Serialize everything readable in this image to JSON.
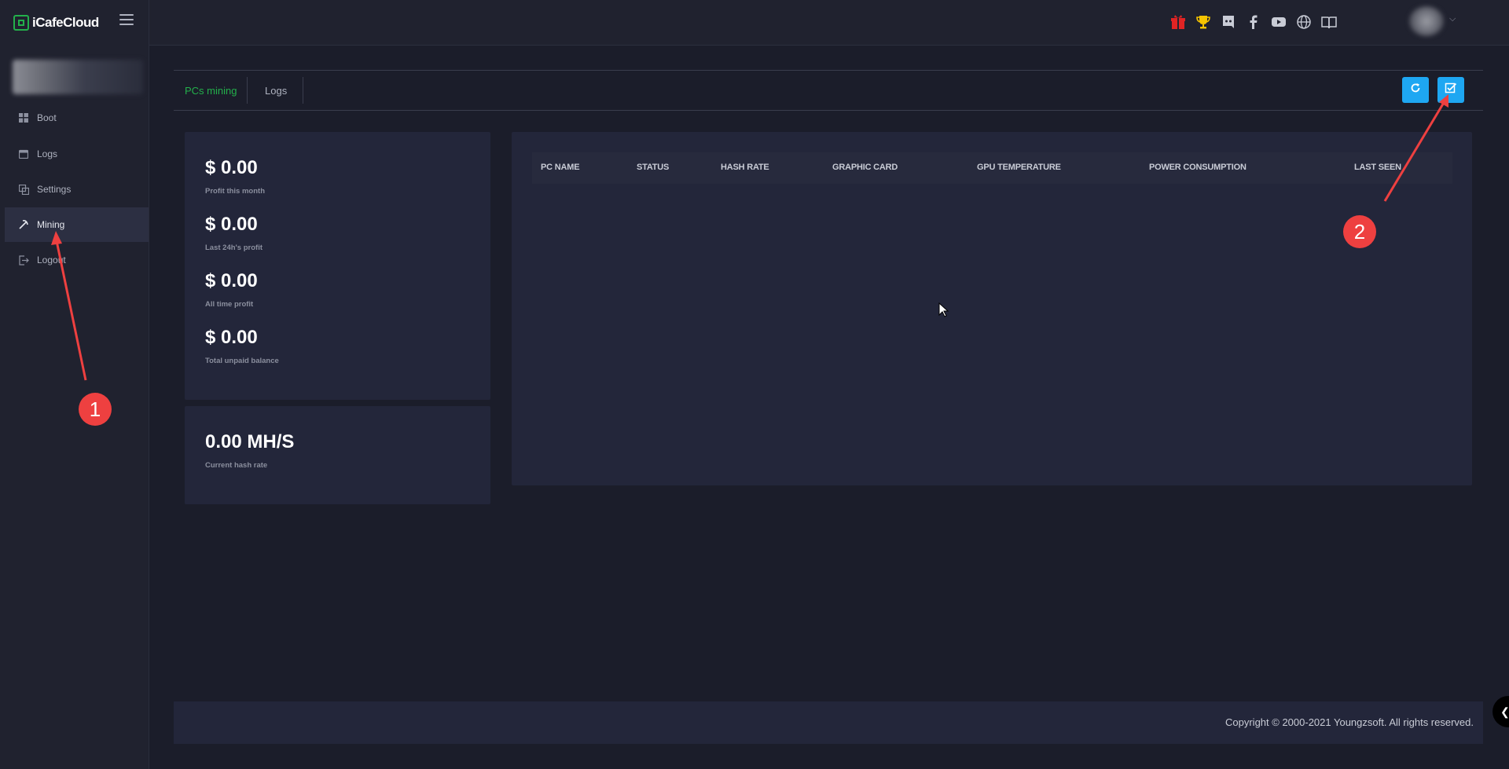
{
  "app": {
    "logo_text": "iCafeCloud"
  },
  "sidebar": {
    "items": [
      {
        "label": "Boot",
        "icon": "windows-icon"
      },
      {
        "label": "Logs",
        "icon": "calendar-icon"
      },
      {
        "label": "Settings",
        "icon": "settings-icon"
      },
      {
        "label": "Mining",
        "icon": "pickaxe-icon",
        "active": true
      },
      {
        "label": "Logout",
        "icon": "logout-icon"
      }
    ]
  },
  "topbar": {
    "icons": [
      "gift-icon",
      "trophy-icon",
      "discord-icon",
      "facebook-icon",
      "youtube-icon",
      "globe-icon",
      "book-icon"
    ]
  },
  "tabs": [
    {
      "label": "PCs mining",
      "active": true
    },
    {
      "label": "Logs",
      "active": false
    }
  ],
  "actions": {
    "refresh_icon": "refresh-icon",
    "checklist_icon": "checklist-icon"
  },
  "stats": [
    {
      "value": "$ 0.00",
      "label": "Profit this month"
    },
    {
      "value": "$ 0.00",
      "label": "Last 24h's profit"
    },
    {
      "value": "$ 0.00",
      "label": "All time profit"
    },
    {
      "value": "$ 0.00",
      "label": "Total unpaid balance"
    }
  ],
  "hashrate": {
    "value": "0.00 MH/S",
    "label": "Current hash rate"
  },
  "table": {
    "columns": [
      "PC NAME",
      "STATUS",
      "HASH RATE",
      "GRAPHIC CARD",
      "GPU TEMPERATURE",
      "POWER CONSUMPTION",
      "LAST SEEN"
    ],
    "rows": []
  },
  "footer": {
    "copyright": "Copyright © 2000-2021 Youngzsoft. All rights reserved."
  },
  "annotations": [
    {
      "label": "1"
    },
    {
      "label": "2"
    }
  ],
  "colors": {
    "accent_green": "#23b04b",
    "button_blue": "#1ea7f2",
    "annotation_red": "#ee4040",
    "background": "#1b1d2a"
  }
}
